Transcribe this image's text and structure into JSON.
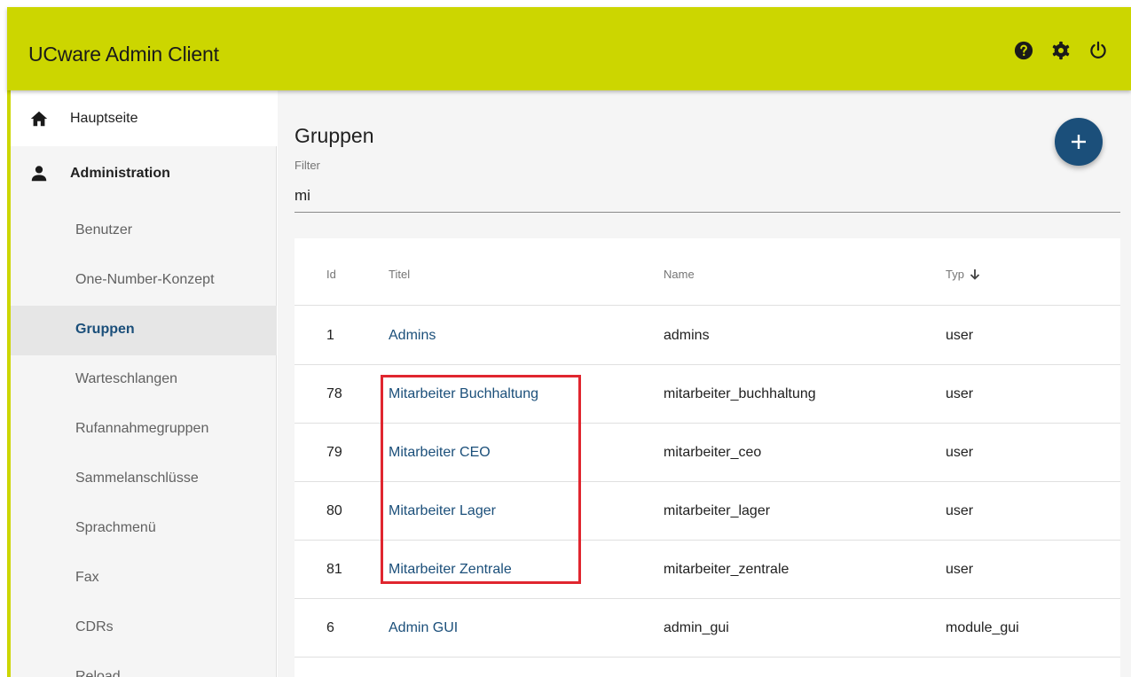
{
  "app": {
    "title": "UCware Admin Client"
  },
  "header_icons": [
    {
      "name": "help-icon",
      "color": "#1a1a1a"
    },
    {
      "name": "gear-icon",
      "color": "#1a1a1a"
    },
    {
      "name": "power-icon",
      "color": "#1a1a1a"
    }
  ],
  "sidebar": {
    "home": {
      "label": "Hauptseite",
      "icon": "home-icon"
    },
    "admin": {
      "label": "Administration",
      "icon": "person-icon"
    },
    "items": [
      {
        "label": "Benutzer"
      },
      {
        "label": "One-Number-Konzept"
      },
      {
        "label": "Gruppen",
        "active": true
      },
      {
        "label": "Warteschlangen"
      },
      {
        "label": "Rufannahmegruppen"
      },
      {
        "label": "Sammelanschlüsse"
      },
      {
        "label": "Sprachmenü"
      },
      {
        "label": "Fax"
      },
      {
        "label": "CDRs"
      },
      {
        "label": "Reload"
      }
    ]
  },
  "main": {
    "title": "Gruppen",
    "add_icon": "plus-icon",
    "filter": {
      "label": "Filter",
      "value": "mi"
    },
    "table": {
      "columns": [
        "Id",
        "Titel",
        "Name",
        "Typ"
      ],
      "sort_column": "Typ",
      "sort_direction": "descending",
      "rows": [
        {
          "id": "1",
          "titel": "Admins",
          "name": "admins",
          "typ": "user"
        },
        {
          "id": "78",
          "titel": "Mitarbeiter Buchhaltung",
          "name": "mitarbeiter_buchhaltung",
          "typ": "user"
        },
        {
          "id": "79",
          "titel": "Mitarbeiter CEO",
          "name": "mitarbeiter_ceo",
          "typ": "user"
        },
        {
          "id": "80",
          "titel": "Mitarbeiter Lager",
          "name": "mitarbeiter_lager",
          "typ": "user"
        },
        {
          "id": "81",
          "titel": "Mitarbeiter Zentrale",
          "name": "mitarbeiter_zentrale",
          "typ": "user"
        },
        {
          "id": "6",
          "titel": "Admin GUI",
          "name": "admin_gui",
          "typ": "module_gui"
        }
      ]
    }
  },
  "colors": {
    "header_bg": "#ccd600",
    "accent_blue": "#1b4f7a",
    "highlight_red": "#e0262f"
  }
}
